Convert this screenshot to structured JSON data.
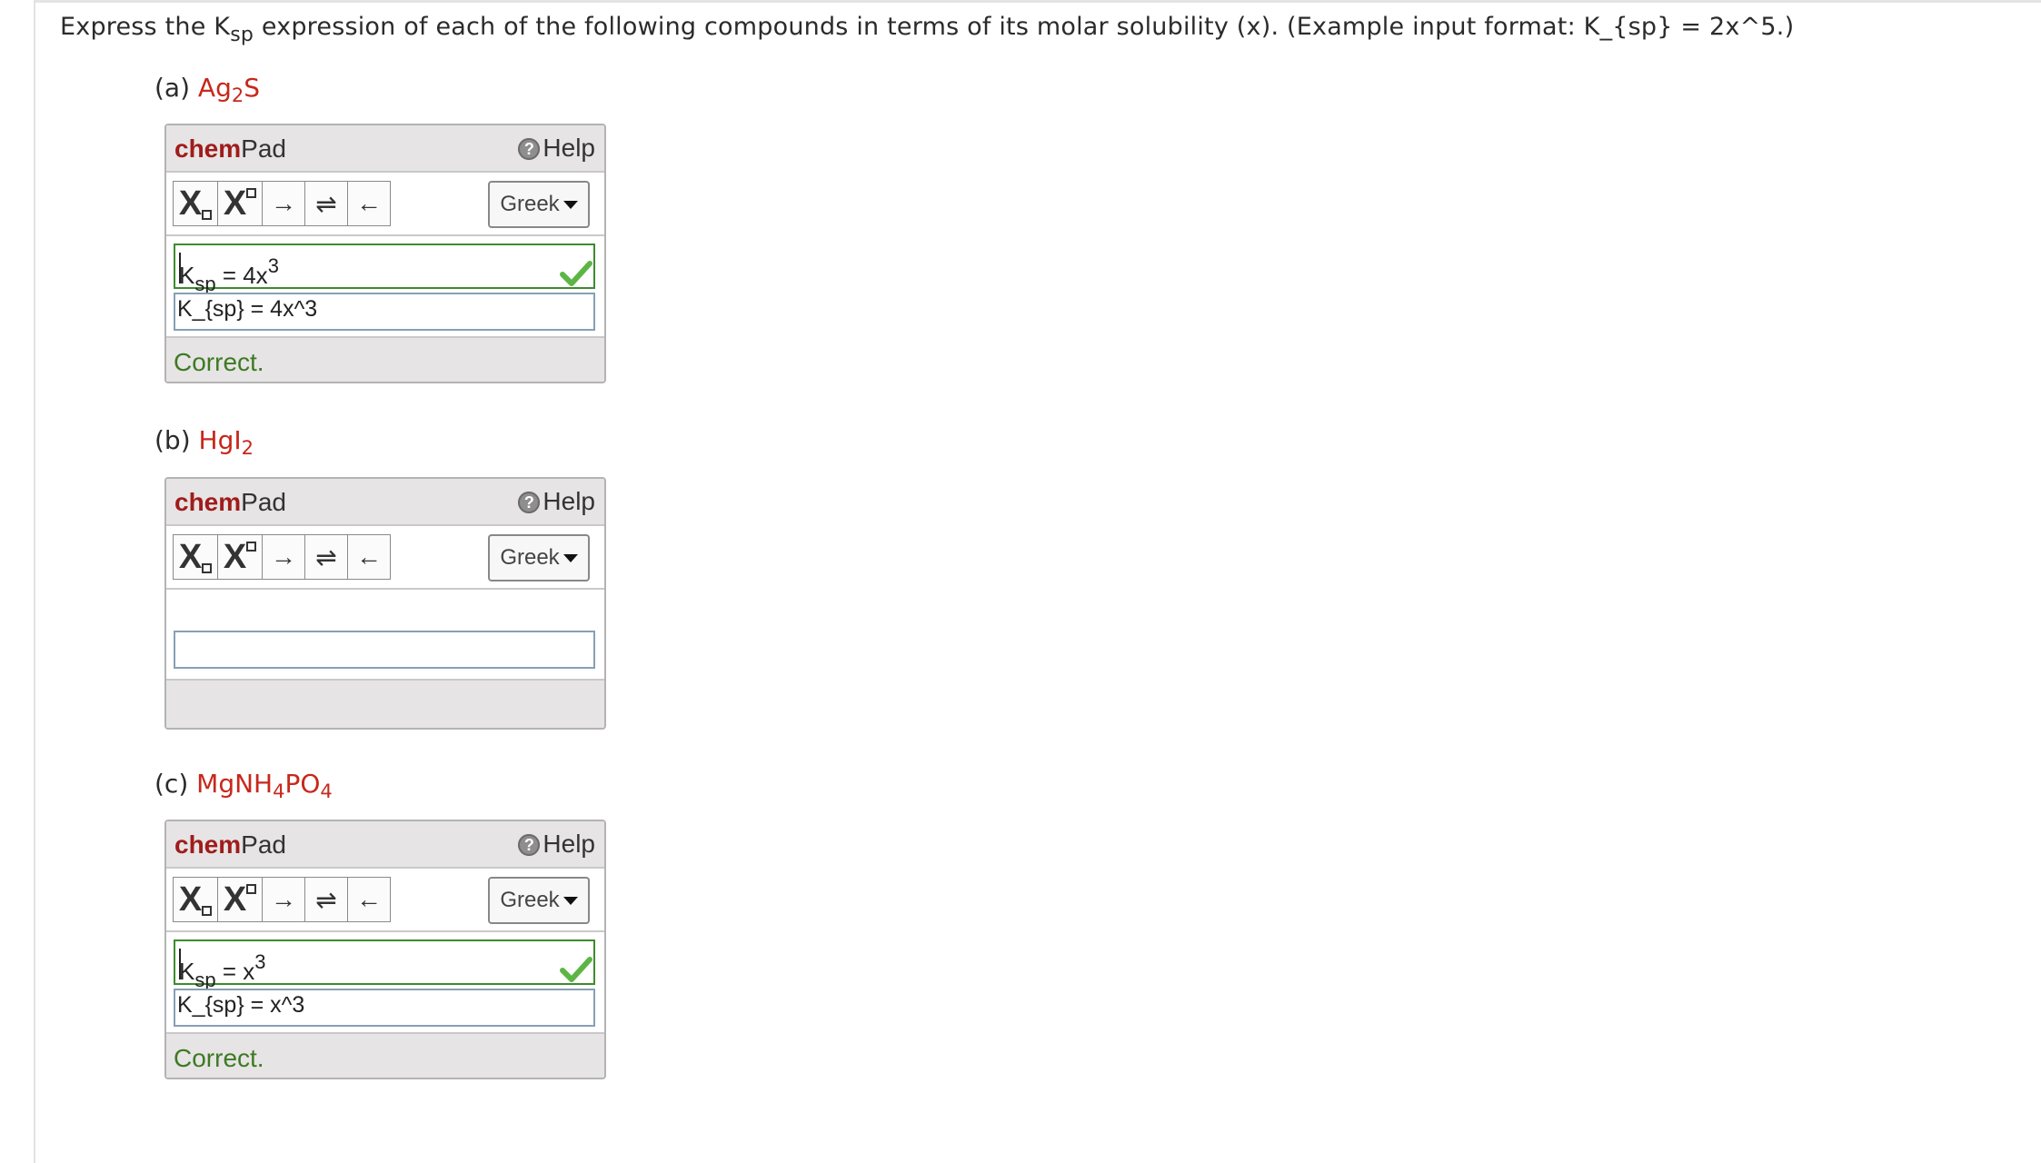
{
  "question": {
    "prefix": "Express the K",
    "sub": "sp",
    "suffix": " expression of each of the following compounds in terms of its molar solubility (x). (Example input format: K_{sp} = 2x^5.)"
  },
  "parts": [
    {
      "letter": "(a)",
      "compound": {
        "a": "Ag",
        "sub": "2",
        "b": "S",
        "sub2": "",
        "c": ""
      },
      "display": {
        "lhs": "K",
        "lhs_sub": "sp",
        "rhs": " = 4x",
        "rhs_sup": "3"
      },
      "input_value": "K_{sp} = 4x^3",
      "status": "Correct."
    },
    {
      "letter": "(b)",
      "compound": {
        "a": "HgI",
        "sub": "2",
        "b": "",
        "sub2": "",
        "c": ""
      },
      "display": null,
      "input_value": "",
      "status": ""
    },
    {
      "letter": "(c)",
      "compound": {
        "a": "MgNH",
        "sub": "4",
        "b": "PO",
        "sub2": "4",
        "c": ""
      },
      "display": {
        "lhs": "K",
        "lhs_sub": "sp",
        "rhs": " = x",
        "rhs_sup": "3"
      },
      "input_value": "K_{sp} = x^3",
      "status": "Correct."
    }
  ],
  "chempad": {
    "title_bold": "chem",
    "title_rest": "Pad",
    "help_label": "Help",
    "help_icon": "question-circle-icon",
    "tool_subscript": "X",
    "tool_superscript": "X",
    "tool_arrow": "→",
    "tool_equilibrium": "⇌",
    "tool_back": "←",
    "greek_label": "Greek"
  },
  "colors": {
    "compound": "#c7281b",
    "chem_brand": "#a11b1b",
    "correct_text": "#3d7a24",
    "check": "#5cb545"
  }
}
